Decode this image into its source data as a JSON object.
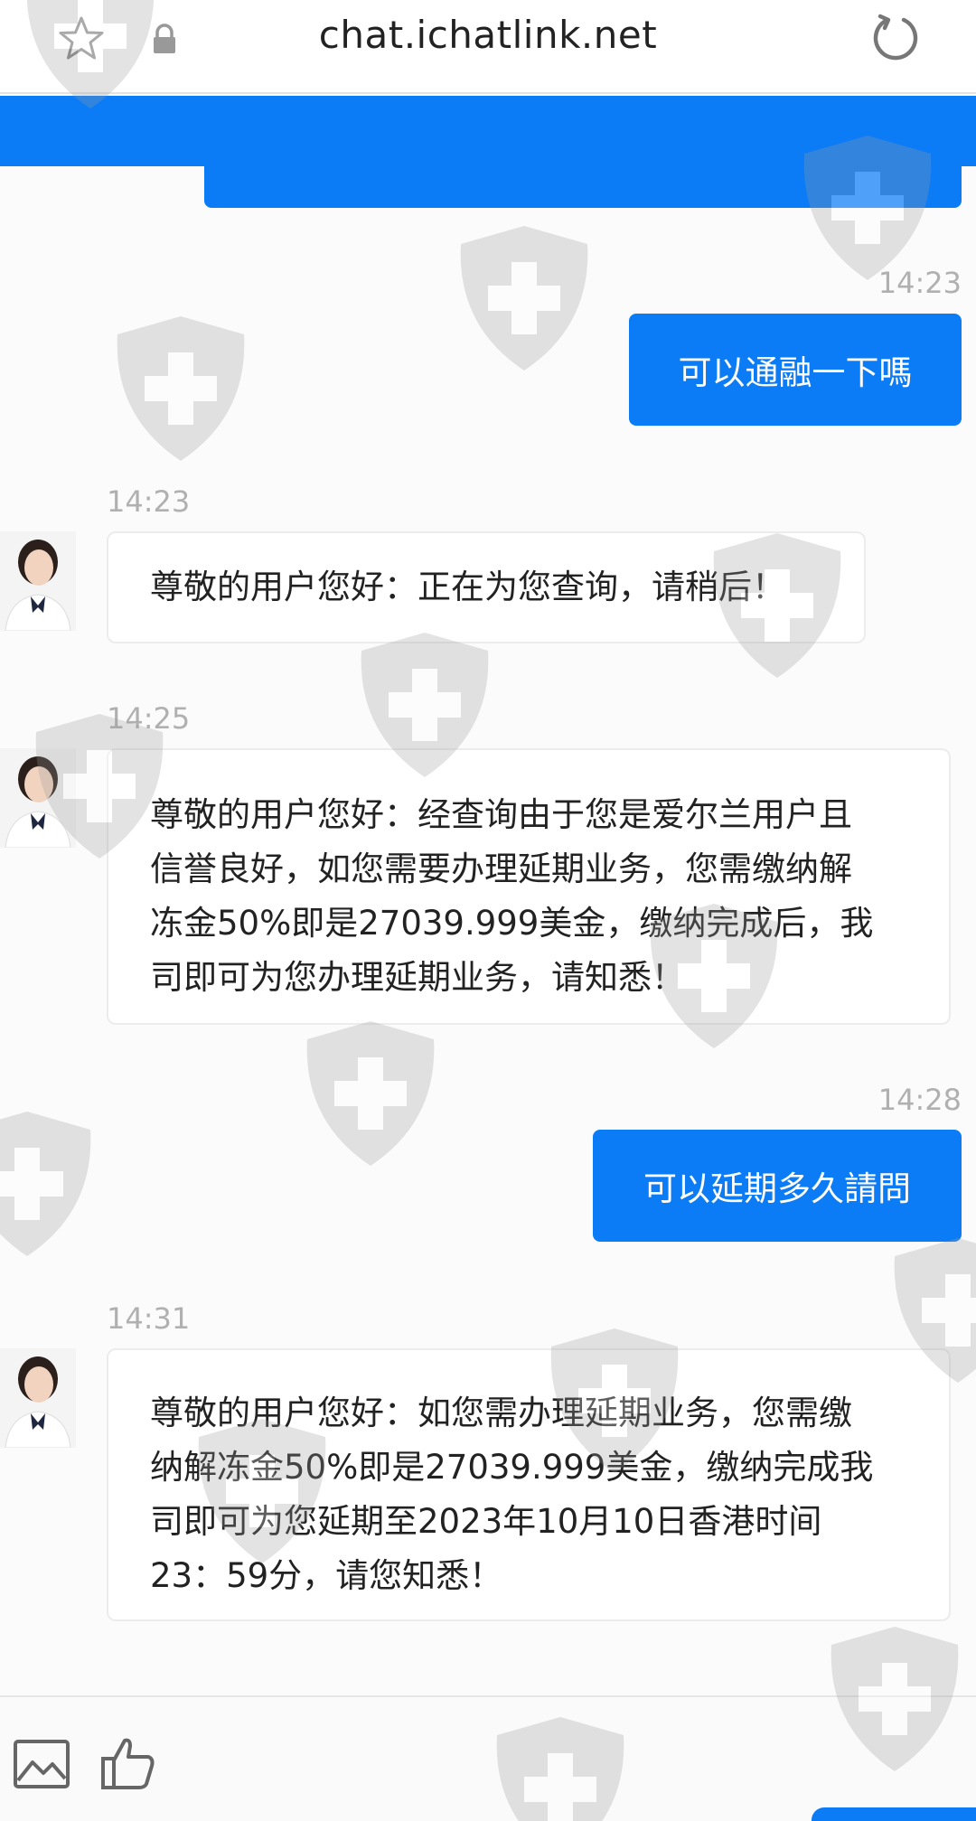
{
  "browser": {
    "url": "chat.ichatlink.net",
    "icons": {
      "favorite": "star-icon",
      "secure": "lock-icon",
      "reload": "reload-icon"
    }
  },
  "colors": {
    "accent": "#0b7cf5",
    "timestamp": "#b0b0b0",
    "background": "#fbfbfb"
  },
  "messages": [
    {
      "direction": "out",
      "time": "14:23",
      "text": "可以通融一下嗎"
    },
    {
      "direction": "in",
      "time": "14:23",
      "lines": [
        "尊敬的用户您好：正在为您查询，请稍后！"
      ]
    },
    {
      "direction": "in",
      "time": "14:25",
      "lines": [
        "尊敬的用户您好：经查询由于您是爱尔兰用户且",
        "信誉良好，如您需要办理延期业务，您需缴纳解",
        "冻金50%即是27039.999美金，缴纳完成后，我",
        "司即可为您办理延期业务，请知悉！"
      ]
    },
    {
      "direction": "out",
      "time": "14:28",
      "text": "可以延期多久請問"
    },
    {
      "direction": "in",
      "time": "14:31",
      "lines": [
        "尊敬的用户您好：如您需办理延期业务，您需缴",
        "纳解冻金50%即是27039.999美金，缴纳完成我",
        "司即可为您延期至2023年10月10日香港时间",
        "23：59分，请您知悉！"
      ]
    }
  ],
  "toolbar": {
    "icons": [
      "image-icon",
      "thumbs-up-icon"
    ]
  }
}
